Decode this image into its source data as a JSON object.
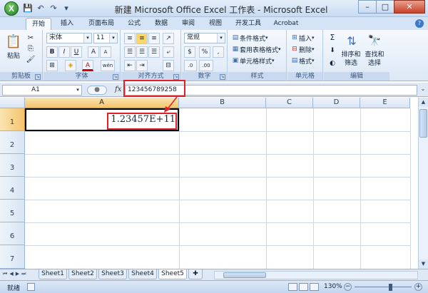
{
  "window": {
    "title": "新建 Microsoft Office Excel 工作表 - Microsoft Excel",
    "minimize": "–",
    "maximize": "□",
    "close": "✕"
  },
  "qat": {
    "save": "💾",
    "undo": "↶",
    "redo": "↷",
    "more": "▾"
  },
  "tabs": [
    "开始",
    "插入",
    "页面布局",
    "公式",
    "数据",
    "审阅",
    "视图",
    "开发工具",
    "Acrobat"
  ],
  "active_tab": "开始",
  "ribbon": {
    "clipboard": {
      "label": "剪贴板",
      "paste": "粘贴",
      "cut_icon": "scissors-icon",
      "copy_icon": "copy-icon",
      "format_painter_icon": "brush-icon"
    },
    "font": {
      "label": "字体",
      "font_name": "宋体",
      "font_size": "11",
      "bold": "B",
      "italic": "I",
      "underline": "U",
      "grow": "A",
      "shrink": "A",
      "border": "⊞",
      "fill": "◈",
      "color": "A",
      "phonetic": "wén"
    },
    "alignment": {
      "label": "对齐方式"
    },
    "number": {
      "label": "数字",
      "format": "常规",
      "currency": "$",
      "percent": "%",
      "comma": ",",
      "inc_decimal": ".0",
      "dec_decimal": ".00"
    },
    "styles": {
      "label": "样式",
      "conditional": "条件格式",
      "table": "套用表格格式",
      "cell_styles": "单元格样式"
    },
    "cells": {
      "label": "单元格",
      "insert": "插入",
      "delete": "删除",
      "format": "格式"
    },
    "editing": {
      "label": "编辑",
      "sum": "Σ",
      "sort_filter_1": "排序和",
      "sort_filter_2": "筛选",
      "find_select_1": "查找和",
      "find_select_2": "选择"
    }
  },
  "formula_bar": {
    "name_box": "A1",
    "fx": "fx",
    "value": "123456789258"
  },
  "grid": {
    "columns": [
      "A",
      "B",
      "C",
      "D",
      "E"
    ],
    "rows": [
      "1",
      "2",
      "3",
      "4",
      "5",
      "6",
      "7"
    ],
    "cell_a1": "1.23457E+11"
  },
  "sheets": [
    "Sheet1",
    "Sheet2",
    "Sheet3",
    "Sheet4",
    "Sheet5"
  ],
  "active_sheet": "Sheet5",
  "status": {
    "ready": "就绪",
    "zoom": "130%"
  },
  "colors": {
    "highlight_red": "#e3202a",
    "selected_header": "#f4c46c",
    "ribbon_blue": "#dce8f6"
  }
}
